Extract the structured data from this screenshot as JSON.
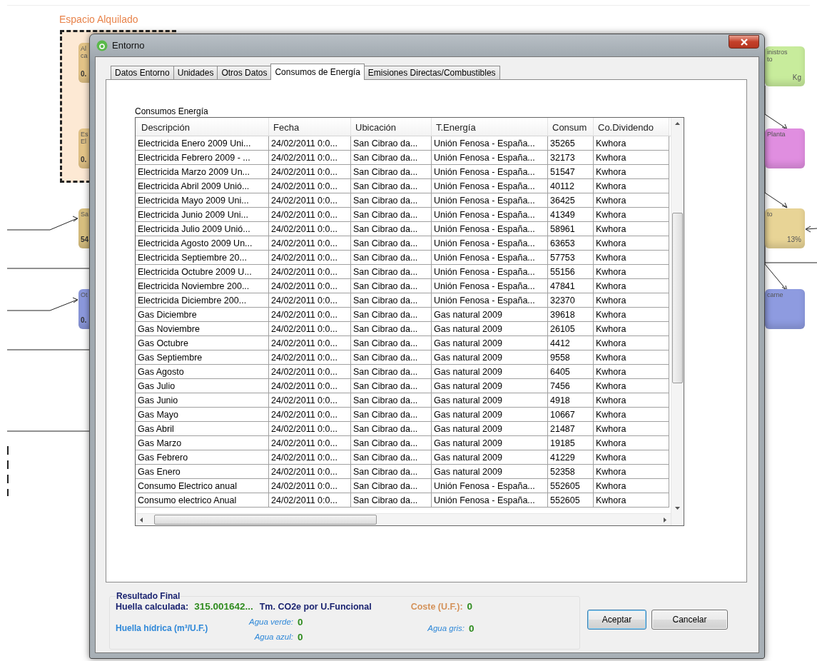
{
  "diagram": {
    "area_label": "Espacio Alquilado",
    "nodes": [
      {
        "lines": [
          "Al",
          "ca"
        ],
        "value": "0.",
        "color": "#e8c88a"
      },
      {
        "lines": [
          "Es",
          "El"
        ],
        "value": "0.",
        "color": "#e8c88a"
      },
      {
        "lines": [
          "Sa"
        ],
        "value": "54",
        "color": "#dcc382"
      },
      {
        "lines": [
          "Ot"
        ],
        "value": "0.",
        "color": "#8e9be0"
      },
      {
        "lines": [
          "inistros",
          "to"
        ],
        "value": "Kg",
        "color": "#c8ec9c"
      },
      {
        "lines": [
          "Planta"
        ],
        "color": "#e08ee0"
      },
      {
        "lines": [
          "to"
        ],
        "value": "13%",
        "color": "#e8d496"
      },
      {
        "lines": [
          "carne"
        ],
        "color": "#8e9be0"
      }
    ]
  },
  "window": {
    "title": "Entorno"
  },
  "tabs": [
    {
      "label": "Datos Entorno",
      "selected": false
    },
    {
      "label": "Unidades",
      "selected": false
    },
    {
      "label": "Otros Datos",
      "selected": false
    },
    {
      "label": "Consumos de Energía",
      "selected": true
    },
    {
      "label": "Emisiones Directas/Combustibles",
      "selected": false
    }
  ],
  "group_label": "Consumos Energía",
  "table": {
    "columns": [
      "Descripción",
      "Fecha",
      "Ubicación",
      "T.Energía",
      "Consum",
      "Co.Dividendo"
    ],
    "rows": [
      [
        "Electricida Enero 2009 Uni...",
        "24/02/2011 0:0...",
        "San Cibrao da...",
        "Unión Fenosa - España...",
        "35265",
        "Kwhora"
      ],
      [
        "Electricida Febrero 2009 - ...",
        "24/02/2011 0:0...",
        "San Cibrao da...",
        "Unión Fenosa - España...",
        "32173",
        "Kwhora"
      ],
      [
        "Electricida Marzo 2009 Un...",
        "24/02/2011 0:0...",
        "San Cibrao da...",
        "Unión Fenosa - España...",
        "51547",
        "Kwhora"
      ],
      [
        "Electricida Abril 2009 Unió...",
        "24/02/2011 0:0...",
        "San Cibrao da...",
        "Unión Fenosa - España...",
        "40112",
        "Kwhora"
      ],
      [
        "Electricida Mayo 2009 Uni...",
        "24/02/2011 0:0...",
        "San Cibrao da...",
        "Unión Fenosa - España...",
        "36425",
        "Kwhora"
      ],
      [
        "Electricida Junio 2009 Uni...",
        "24/02/2011 0:0...",
        "San Cibrao da...",
        "Unión Fenosa - España...",
        "41349",
        "Kwhora"
      ],
      [
        "Electricida Julio 2009 Unió...",
        "24/02/2011 0:0...",
        "San Cibrao da...",
        "Unión Fenosa - España...",
        "58961",
        "Kwhora"
      ],
      [
        "Electricida Agosto 2009 Un...",
        "24/02/2011 0:0...",
        "San Cibrao da...",
        "Unión Fenosa - España...",
        "63653",
        "Kwhora"
      ],
      [
        "Electricida Septiembre 20...",
        "24/02/2011 0:0...",
        "San Cibrao da...",
        "Unión Fenosa - España...",
        "57753",
        "Kwhora"
      ],
      [
        "Electricida Octubre 2009 U...",
        "24/02/2011 0:0...",
        "San Cibrao da...",
        "Unión Fenosa - España...",
        "55156",
        "Kwhora"
      ],
      [
        "Electricida Noviembre 200...",
        "24/02/2011 0:0...",
        "San Cibrao da...",
        "Unión Fenosa - España...",
        "47841",
        "Kwhora"
      ],
      [
        "Electricida Diciembre 200...",
        "24/02/2011 0:0...",
        "San Cibrao da...",
        "Unión Fenosa - España...",
        "32370",
        "Kwhora"
      ],
      [
        "Gas Diciembre",
        "24/02/2011 0:0...",
        "San Cibrao da...",
        "Gas natural 2009",
        "39618",
        "Kwhora"
      ],
      [
        "Gas Noviembre",
        "24/02/2011 0:0...",
        "San Cibrao da...",
        "Gas natural 2009",
        "26105",
        "Kwhora"
      ],
      [
        "Gas Octubre",
        "24/02/2011 0:0...",
        "San Cibrao da...",
        "Gas natural 2009",
        "4412",
        "Kwhora"
      ],
      [
        "Gas Septiembre",
        "24/02/2011 0:0...",
        "San Cibrao da...",
        "Gas natural 2009",
        "9558",
        "Kwhora"
      ],
      [
        "Gas Agosto",
        "24/02/2011 0:0...",
        "San Cibrao da...",
        "Gas natural 2009",
        "6405",
        "Kwhora"
      ],
      [
        "Gas Julio",
        "24/02/2011 0:0...",
        "San Cibrao da...",
        "Gas natural 2009",
        "7456",
        "Kwhora"
      ],
      [
        "Gas Junio",
        "24/02/2011 0:0...",
        "San Cibrao da...",
        "Gas natural 2009",
        "4918",
        "Kwhora"
      ],
      [
        "Gas Mayo",
        "24/02/2011 0:0...",
        "San Cibrao da...",
        "Gas natural 2009",
        "10667",
        "Kwhora"
      ],
      [
        "Gas Abril",
        "24/02/2011 0:0...",
        "San Cibrao da...",
        "Gas natural 2009",
        "21487",
        "Kwhora"
      ],
      [
        "Gas Marzo",
        "24/02/2011 0:0...",
        "San Cibrao da...",
        "Gas natural 2009",
        "19185",
        "Kwhora"
      ],
      [
        "Gas Febrero",
        "24/02/2011 0:0...",
        "San Cibrao da...",
        "Gas natural 2009",
        "41229",
        "Kwhora"
      ],
      [
        "Gas Enero",
        "24/02/2011 0:0...",
        "San Cibrao da...",
        "Gas natural 2009",
        "52358",
        "Kwhora"
      ],
      [
        "Consumo Electrico anual",
        "24/02/2011 0:0...",
        "San Cibrao da...",
        "Unión Fenosa - España...",
        "552605",
        "Kwhora"
      ],
      [
        "Consumo electrico Anual",
        "24/02/2011 0:0...",
        "San Cibrao da...",
        "Unión Fenosa - España...",
        "552605",
        "Kwhora"
      ]
    ]
  },
  "result": {
    "title": "Resultado Final",
    "footprint_label": "Huella calculada:",
    "footprint_value": "315.001642...",
    "footprint_unit": "Tm. CO2e por U.Funcional",
    "cost_label": "Coste (U.F.):",
    "cost_value": "0",
    "water_label": "Huella hídrica (m³/U.F.)",
    "green_label": "Agua verde:",
    "green_value": "0",
    "blue_label": "Agua azul:",
    "blue_value": "0",
    "grey_label": "Agua gris:",
    "grey_value": "0"
  },
  "buttons": [
    {
      "label": "Aceptar",
      "default": true
    },
    {
      "label": "Cancelar",
      "default": false
    }
  ]
}
